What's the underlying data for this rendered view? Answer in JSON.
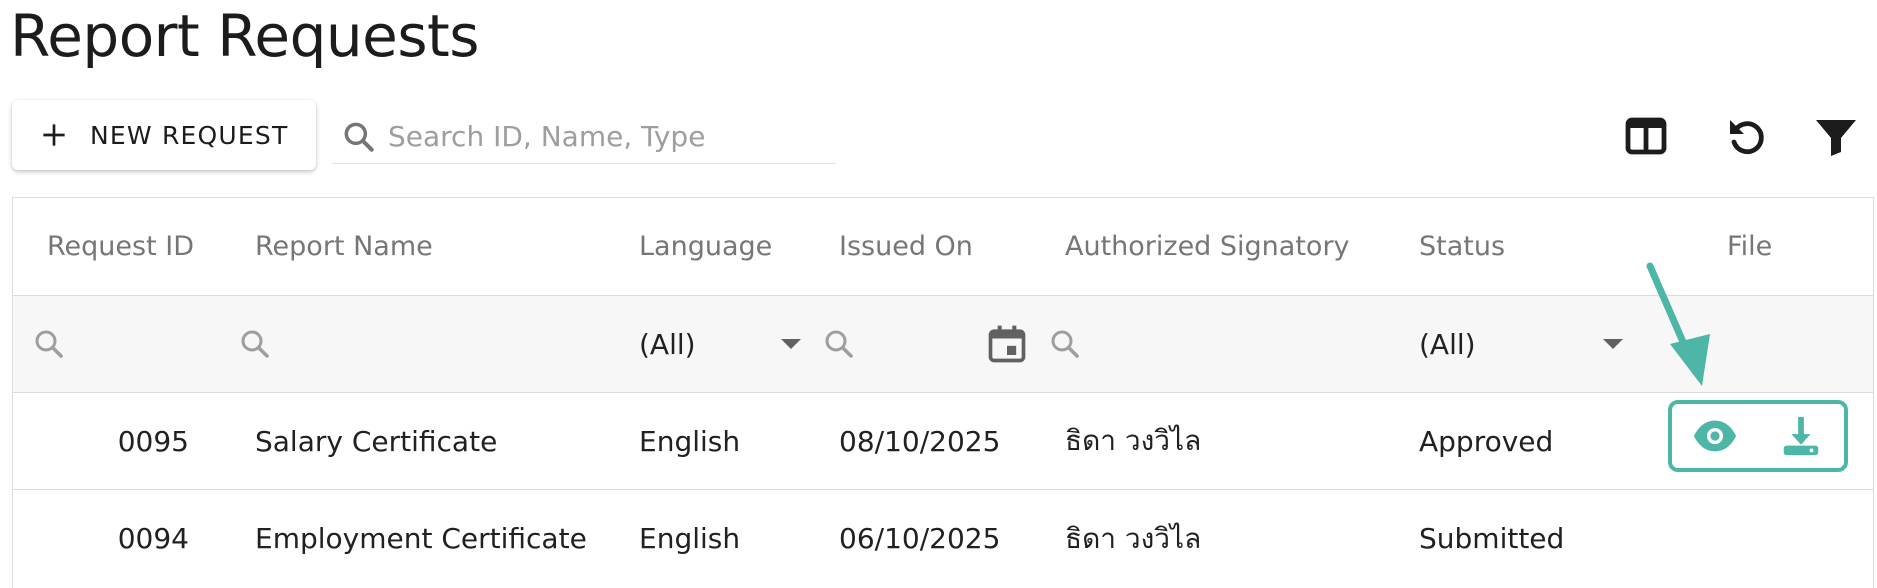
{
  "page": {
    "title": "Report Requests"
  },
  "toolbar": {
    "new_request_label": "NEW REQUEST",
    "search_placeholder": "Search ID, Name, Type",
    "search_value": "",
    "icons": [
      "column-chooser-icon",
      "refresh-icon",
      "filter-icon"
    ]
  },
  "table": {
    "columns": [
      "Request ID",
      "Report Name",
      "Language",
      "Issued On",
      "Authorized Signatory",
      "Status",
      "File"
    ],
    "filters": {
      "language": "(All)",
      "status": "(All)"
    },
    "rows": [
      {
        "id": "0095",
        "name": "Salary Certificate",
        "language": "English",
        "issued_on": "08/10/2025",
        "signatory": "ธิดา วงวิไล",
        "status": "Approved"
      },
      {
        "id": "0094",
        "name": "Employment Certificate",
        "language": "English",
        "issued_on": "06/10/2025",
        "signatory": "ธิดา วงวิไล",
        "status": "Submitted"
      }
    ]
  },
  "colors": {
    "accent": "#4db6a7",
    "icon": "#1c1c1c",
    "muted": "#9e9e9e"
  }
}
